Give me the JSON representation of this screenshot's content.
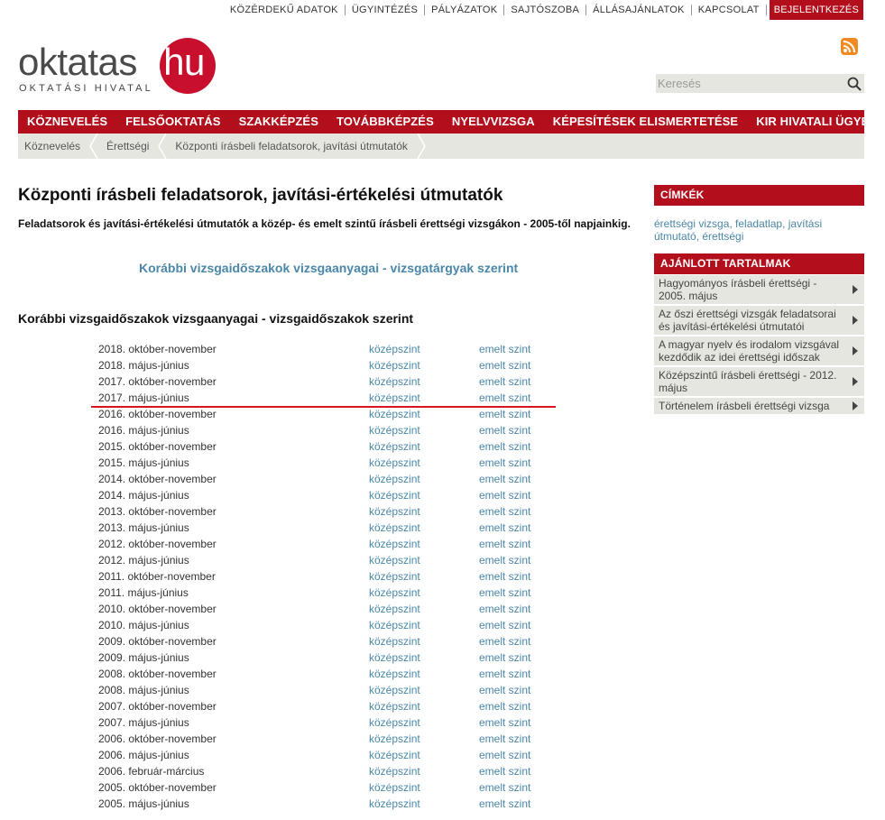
{
  "topbar": {
    "links": [
      "KÖZÉRDEKŰ ADATOK",
      "ÜGYINTÉZÉS",
      "PÁLYÁZATOK",
      "SAJTÓSZOBA",
      "ÁLLÁSAJÁNLATOK",
      "KAPCSOLAT"
    ],
    "login": "BEJELENTKEZÉS"
  },
  "logo": {
    "word": "oktatas",
    "hu": ".hu",
    "sub": "OKTATÁSI HIVATAL"
  },
  "search": {
    "placeholder": "Keresés"
  },
  "nav": [
    "KÖZNEVELÉS",
    "FELSŐOKTATÁS",
    "SZAKKÉPZÉS",
    "TOVÁBBKÉPZÉS",
    "NYELVVIZSGA",
    "KÉPESÍTÉSEK ELISMERTETÉSE",
    "KIR HIVATALI ÜGYEK"
  ],
  "breadcrumb": [
    "Köznevelés",
    "Érettségi",
    "Központi írásbeli feladatsorok, javítási útmutatók"
  ],
  "main": {
    "title": "Központi írásbeli feladatsorok, javítási-értékelési útmutatók",
    "lead": "Feladatsorok és javítási-értékelési útmutatók a közép- és emelt szintű írásbeli érettségi vizsgákon - 2005-től napjainkig.",
    "sublink": "Korábbi vizsgaidőszakok vizsgaanyagai - vizsgatárgyak szerint",
    "section_title": "Korábbi vizsgaidőszakok vizsgaanyagai - vizsgaidőszakok szerint",
    "mid_label": "középszint",
    "adv_label": "emelt szint",
    "periods": [
      "2018. október-november",
      "2018. május-június",
      "2017. október-november",
      "2017. május-június",
      "2016. október-november",
      "2016. május-június",
      "2015. október-november",
      "2015. május-június",
      "2014. október-november",
      "2014. május-június",
      "2013. október-november",
      "2013. május-június",
      "2012. október-november",
      "2012. május-június",
      "2011. október-november",
      "2011. május-június",
      "2010. október-november",
      "2010. május-június",
      "2009. október-november",
      "2009. május-június",
      "2008. október-november",
      "2008. május-június",
      "2007. október-november",
      "2007. május-június",
      "2006. október-november",
      "2006. május-június",
      "2006. február-március",
      "2005. október-november",
      "2005. május-június"
    ]
  },
  "sidebar": {
    "tags_title": "CÍMKÉK",
    "tags": [
      "érettségi vizsga",
      "feladatlap",
      "javítási útmutató",
      "érettségi"
    ],
    "rec_title": "AJÁNLOTT TARTALMAK",
    "rec_items": [
      "Hagyományos írásbeli érettségi - 2005. május",
      "Az őszi érettségi vizsgák feladatsorai és javítási-értékelési útmutatói",
      "A magyar nyelv és irodalom vizsgával kezdődik az idei érettségi időszak",
      "Középszintű írásbeli érettségi - 2012. május",
      "Történelem írásbeli érettségi vizsga"
    ]
  },
  "colors": {
    "brand_red": "#b30e1c",
    "logo_red": "#c8102e",
    "link_blue": "#4a87a8",
    "bar_gray": "#e6e6e0",
    "annotation_red": "#d8141e"
  }
}
